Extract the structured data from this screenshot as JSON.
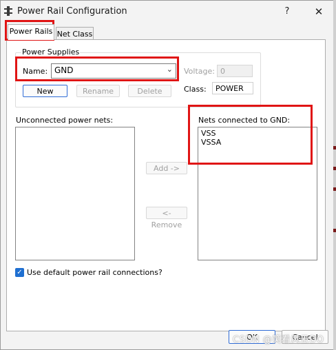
{
  "window": {
    "title": "Power Rail Configuration",
    "help_label": "?",
    "close_label": "✕"
  },
  "tabs": [
    {
      "label": "Power Rails"
    },
    {
      "label": "Net Class"
    }
  ],
  "power_supplies": {
    "group_label": "Power Supplies",
    "name_label": "Name:",
    "name_value": "GND",
    "voltage_label": "Voltage:",
    "voltage_value": "0",
    "new_label": "New",
    "rename_label": "Rename",
    "delete_label": "Delete",
    "class_label": "Class:",
    "class_value": "POWER"
  },
  "unconnected": {
    "label": "Unconnected power nets:",
    "items": []
  },
  "connected": {
    "label": "Nets connected to GND:",
    "items": [
      "VSS",
      "VSSA"
    ]
  },
  "add_label": "Add ->",
  "remove_label": "<- Remove",
  "default_connections": {
    "label": "Use default power rail connections?",
    "checked": true
  },
  "footer": {
    "ok_label": "OK",
    "cancel_label": "Cancel"
  },
  "watermark": "CSDN @笑看风云DO",
  "colors": {
    "highlight": "#e01414",
    "accent": "#1f6fd1"
  }
}
